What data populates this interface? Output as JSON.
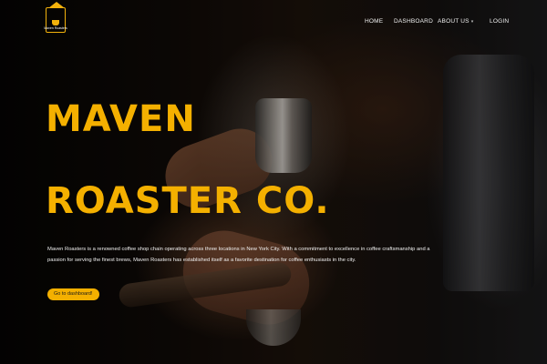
{
  "brand": {
    "logo_text": "Maven Roasters",
    "accent_color": "#f4b000"
  },
  "nav": {
    "home": "HOME",
    "dashboard": "DASHBOARD",
    "about": "ABOUT US",
    "about_icon": "chevron-down-icon",
    "login": "LOGIN"
  },
  "hero": {
    "title_line1": "MAVEN",
    "title_line2": "ROASTER CO.",
    "description": "Maven Roasters is a renowned coffee shop chain operating across three locations in New York City. With a commitment to excellence in coffee craftsmanship and a passion for serving the finest brews, Maven Roasters has established itself as a favorite destination for coffee enthusiasts in the city.",
    "cta_label": "Go to dashboard!"
  }
}
